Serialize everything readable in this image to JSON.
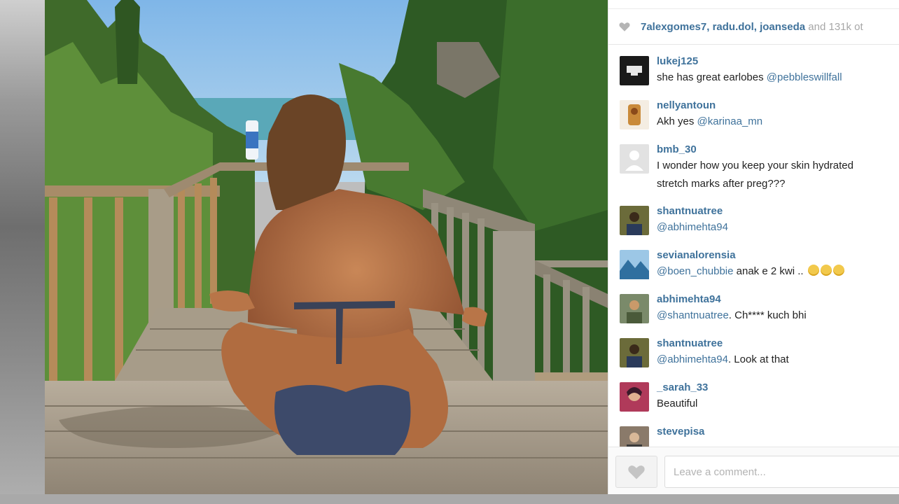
{
  "likes": {
    "users": [
      "7alexgomes7",
      "radu.dol",
      "joanseda"
    ],
    "rest": "and 131k ot"
  },
  "comments": [
    {
      "user": "lukej125",
      "text": "she has great earlobes ",
      "mention": "@pebbleswillfall",
      "avatar": "#1a1a1a"
    },
    {
      "user": "nellyantoun",
      "text": "Akh yes ",
      "mention": "@karinaa_mn",
      "avatar": "#c98a3a"
    },
    {
      "user": "bmb_30",
      "text": "I wonder how you keep your skin hydrated",
      "text2": "stretch marks after preg???",
      "avatar": "#dcdcdc"
    },
    {
      "user": "shantnuatree",
      "mention": "@abhimehta94",
      "text": "",
      "avatar": "#6b6b3a"
    },
    {
      "user": "sevianalorensia",
      "mention": "@boen_chubbie",
      "text": " anak e 2 kwi .. ",
      "avatar": "#4a8fbf"
    },
    {
      "user": "abhimehta94",
      "mention": "@shantnuatree",
      "text": ". Ch**** kuch bhi",
      "avatar": "#7a8a6a"
    },
    {
      "user": "shantnuatree",
      "mention": "@abhimehta94",
      "text": ". Look at that",
      "avatar": "#6b6b3a"
    },
    {
      "user": "_sarah_33",
      "text": "Beautiful",
      "avatar": "#b03a5a"
    },
    {
      "user": "stevepisa",
      "text": "",
      "avatar": "#8a7a6a"
    }
  ],
  "comment_bar": {
    "placeholder": "Leave a comment..."
  },
  "icons": {
    "like": "heart-icon"
  },
  "colors": {
    "link": "#3f729b",
    "text": "#222222"
  }
}
